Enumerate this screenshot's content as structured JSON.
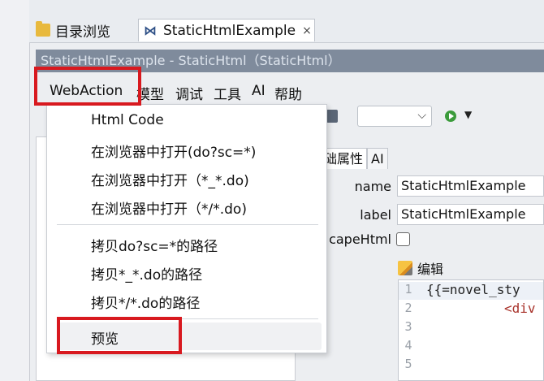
{
  "tabs": [
    {
      "label": "目录浏览",
      "icon": "folder-icon"
    },
    {
      "label": "StaticHtmlExample",
      "icon": "x-node-icon",
      "close": "×"
    }
  ],
  "title_strip": "StaticHtmlExample - StaticHtml（StaticHtml）",
  "menubar": {
    "webaction": "WebAction",
    "items": [
      "模型",
      "调试",
      "工具",
      "AI",
      "帮助"
    ]
  },
  "dropdown": {
    "items": [
      "Html Code",
      "在浏览器中打开(do?sc=*)",
      "在浏览器中打开（*_*.do)",
      "在浏览器中打开（*/*.do)",
      "拷贝do?sc=*的路径",
      "拷贝*_*.do的路径",
      "拷贝*/*.do的路径",
      "预览"
    ]
  },
  "properties": {
    "tabs": [
      "础属性",
      "AI"
    ],
    "name_label": "name",
    "name_value": "StaticHtmlExample",
    "label_label": "label",
    "label_value": "StaticHtmlExample",
    "escape_label": "capeHtml",
    "edit_label": "编辑"
  },
  "editor": {
    "line_numbers": [
      "1",
      "2",
      "3",
      "4",
      "5"
    ],
    "line1": "{{=novel_sty",
    "line2_tag": "<div"
  },
  "colors": {
    "annotation": "#d8191f",
    "title_strip": "#7f8b9c"
  }
}
